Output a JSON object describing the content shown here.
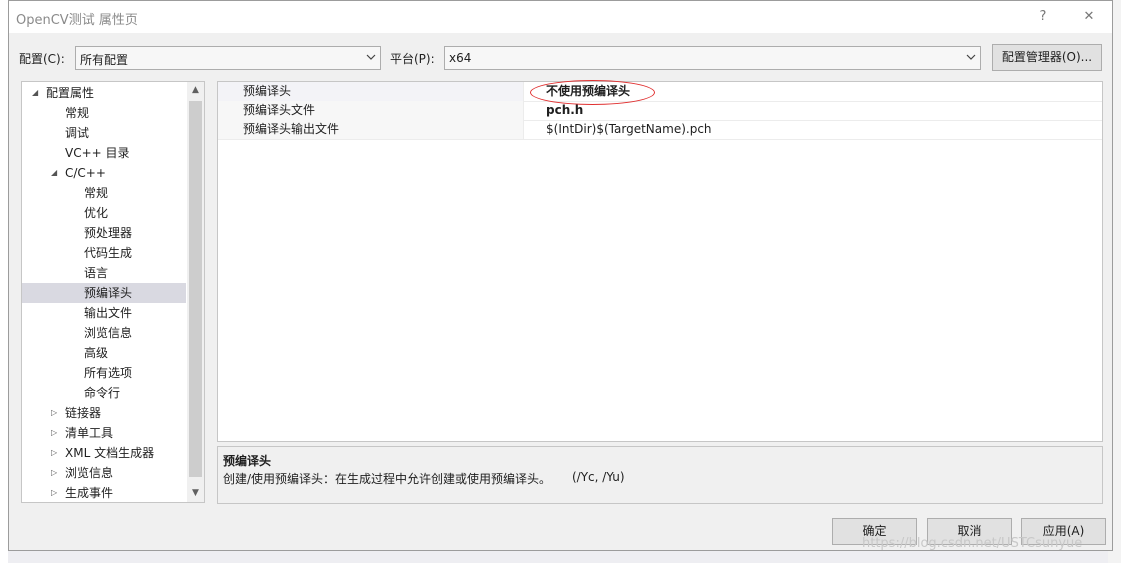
{
  "window": {
    "title": "OpenCV测试 属性页",
    "help_glyph": "?",
    "close_glyph": "✕"
  },
  "config": {
    "label": "配置(C):",
    "value": "所有配置",
    "platform_label": "平台(P):",
    "platform_value": "x64",
    "manager_button": "配置管理器(O)..."
  },
  "tree": {
    "items": [
      {
        "label": "配置属性",
        "level": 0,
        "expander": "expanded"
      },
      {
        "label": "常规",
        "level": 1
      },
      {
        "label": "调试",
        "level": 1
      },
      {
        "label": "VC++ 目录",
        "level": 1
      },
      {
        "label": "C/C++",
        "level": 1,
        "expander": "expanded"
      },
      {
        "label": "常规",
        "level": 2
      },
      {
        "label": "优化",
        "level": 2
      },
      {
        "label": "预处理器",
        "level": 2
      },
      {
        "label": "代码生成",
        "level": 2
      },
      {
        "label": "语言",
        "level": 2
      },
      {
        "label": "预编译头",
        "level": 2,
        "selected": true
      },
      {
        "label": "输出文件",
        "level": 2
      },
      {
        "label": "浏览信息",
        "level": 2
      },
      {
        "label": "高级",
        "level": 2
      },
      {
        "label": "所有选项",
        "level": 2
      },
      {
        "label": "命令行",
        "level": 2
      },
      {
        "label": "链接器",
        "level": 1,
        "expander": "collapsed"
      },
      {
        "label": "清单工具",
        "level": 1,
        "expander": "collapsed"
      },
      {
        "label": "XML 文档生成器",
        "level": 1,
        "expander": "collapsed"
      },
      {
        "label": "浏览信息",
        "level": 1,
        "expander": "collapsed"
      },
      {
        "label": "生成事件",
        "level": 1,
        "expander": "collapsed"
      }
    ]
  },
  "properties": [
    {
      "name": "预编译头",
      "value": "不使用预编译头",
      "bold": true,
      "highlighted": true
    },
    {
      "name": "预编译头文件",
      "value": "pch.h",
      "bold": true
    },
    {
      "name": "预编译头输出文件",
      "value": "$(IntDir)$(TargetName).pch",
      "bold": false
    }
  ],
  "description": {
    "title": "预编译头",
    "text": "创建/使用预编译头：在生成过程中允许创建或使用预编译头。",
    "switch": "(/Yc, /Yu)"
  },
  "buttons": {
    "ok": "确定",
    "cancel": "取消",
    "apply": "应用(A)"
  },
  "watermark": "https://blog.csdn.net/USTCsunyue",
  "colors": {
    "highlight_ellipse": "#e03030",
    "selected_tree": "#d9d9e1"
  }
}
